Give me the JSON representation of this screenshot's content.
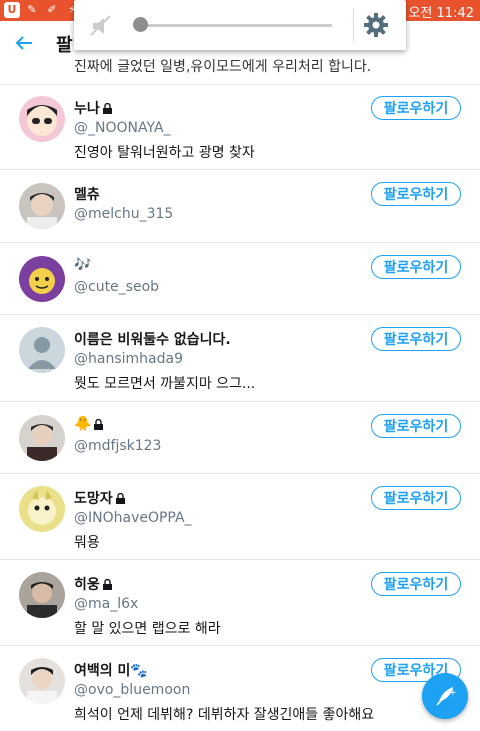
{
  "status_bar": {
    "time": "오전 11:42"
  },
  "app_bar": {
    "title": "팔"
  },
  "volume": {
    "level": 0.0
  },
  "cut_text": "진짜에 글었던 일병,유이모드에게 우리처리 합니다.",
  "users": [
    {
      "name": "누나",
      "locked": true,
      "handle": "@_NOONAYA_",
      "bio": "진영아 탈워너원하고 광명 찾자",
      "follow_label": "팔로우하기",
      "avatar": "avatar-cartoon-girl"
    },
    {
      "name": "멜츄",
      "locked": false,
      "handle": "@melchu_315",
      "bio": "",
      "follow_label": "팔로우하기",
      "avatar": "avatar-photo-boy"
    },
    {
      "name": "🎶",
      "locked": false,
      "handle": "@cute_seob",
      "bio": "",
      "follow_label": "팔로우하기",
      "avatar": "avatar-cartoon-yellow"
    },
    {
      "name": "이름은 비워둘수 없습니다.",
      "locked": false,
      "handle": "@hansimhada9",
      "bio": "뭣도 모르면서 까불지마 으그...",
      "follow_label": "팔로우하기",
      "avatar": "avatar-default"
    },
    {
      "name": "🐥",
      "locked": true,
      "handle": "@mdfjsk123",
      "bio": "",
      "follow_label": "팔로우하기",
      "avatar": "avatar-photo-boy"
    },
    {
      "name": "도망자",
      "locked": true,
      "handle": "@INOhaveOPPA_",
      "bio": "뭐용",
      "follow_label": "팔로우하기",
      "avatar": "avatar-pokemon"
    },
    {
      "name": "히웅",
      "locked": true,
      "handle": "@ma_l6x",
      "bio": "할 말 있으면 랩으로 해라",
      "follow_label": "팔로우하기",
      "avatar": "avatar-photo-kid"
    },
    {
      "name": "여백의 미🐾",
      "locked": false,
      "handle": "@ovo_bluemoon",
      "bio": "희석이 언제 데뷔해? 데뷔하자 잘생긴애들 좋아해요",
      "follow_label": "팔로우하기",
      "avatar": "avatar-photo-boy"
    }
  ],
  "colors": {
    "accent": "#1da1f2",
    "status_bar": "#e8532d"
  }
}
